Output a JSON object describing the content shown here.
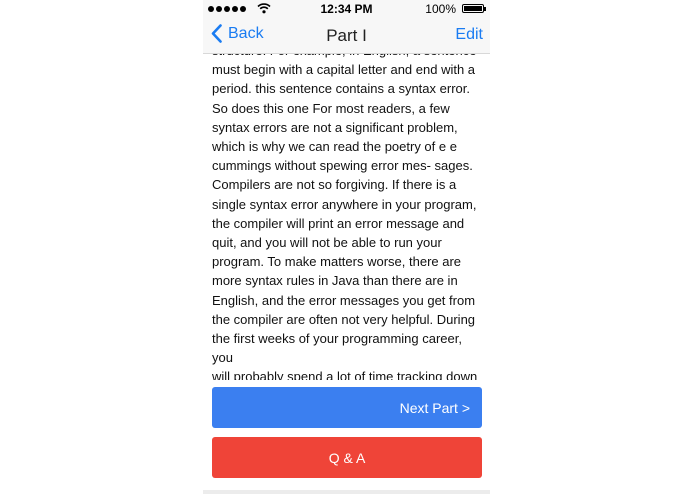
{
  "status_bar": {
    "time": "12:34 PM",
    "battery_percent": "100%",
    "battery_level": 1.0
  },
  "nav": {
    "back_label": "Back",
    "title": "Part I",
    "edit_label": "Edit"
  },
  "content": {
    "body": "structure. For example, in English, a sentence\nmust begin with a capital letter and end with a\nperiod. this sentence contains a syntax error.\nSo does this one For most readers, a few\nsyntax errors are not a significant problem,\nwhich is why we can read the poetry of e e\ncummings without spewing error mes- sages.\nCompilers are not so forgiving. If there is a\nsingle syntax error anywhere in your program,\nthe compiler will print an error message and\nquit, and you will not be able to run your\nprogram. To make matters worse, there are\nmore syntax rules in Java than there are in\nEnglish, and the error messages you get from\nthe compiler are often not very helpful. During\nthe first weeks of your programming career, you\nwill probably spend a lot of time tracking down\nsyntax errors. As you gain experience, you will\nmake fewer errors and find them faster."
  },
  "buttons": {
    "next_part": "Next Part >",
    "qa": "Q & A"
  },
  "colors": {
    "accent": "#1a7cf2",
    "next_button": "#3b7ff0",
    "qa_button": "#ef4438"
  },
  "icons": {
    "signal": "signal-dots-icon",
    "wifi": "wifi-icon",
    "battery": "battery-icon",
    "back": "chevron-left-icon"
  }
}
